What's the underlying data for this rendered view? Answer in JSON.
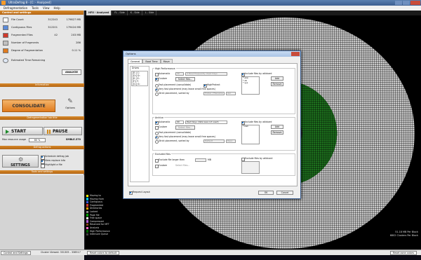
{
  "window": {
    "title": "UltraDefrag 8 - [C: - Analyzed]",
    "menus": [
      "Defragmentation",
      "Tools",
      "View",
      "Help"
    ]
  },
  "panel": {
    "control_header": "Control and settings",
    "stats": [
      {
        "label": "File Count",
        "count": "312243",
        "size": "179827 MB",
        "color": "#ffffff"
      },
      {
        "label": "Contiguous Files",
        "count": "312201",
        "size": "179424 MB",
        "color": "#5b8bd9"
      },
      {
        "label": "Fragmented Files",
        "count": "42",
        "size": "203 MB",
        "color": "#d0392b"
      },
      {
        "label": "Number of Fragments",
        "count": "",
        "size": "286",
        "color": "#c0c0c0"
      },
      {
        "label": "Degree of Fragmentation",
        "count": "",
        "size": "0.11 %",
        "color": "#e07b1e"
      }
    ],
    "estimated_label": "Estimated Time Remaining",
    "analyze_label": "ANALYZE",
    "information_label": "Information",
    "consolidate_label": "CONSOLIDATE",
    "options_label": "Options",
    "defrag_section_label": "Defragmentation tab title",
    "start_label": "START",
    "pause_label": "PAUSE",
    "resource_label": "Max resource usage",
    "resource_value": "80 %",
    "speed_value": "SMBLE.370",
    "defrag_actions_label": "Defrag actions",
    "settings_label": "SETTINGS",
    "checks": [
      {
        "label": "Schedule defrag job",
        "on": true
      },
      {
        "label": "View replace info",
        "on": true
      },
      {
        "label": "Highlight a file",
        "on": false
      }
    ],
    "tools_label": "Tools and settings"
  },
  "map": {
    "tabs": [
      "HFO - Analyzed",
      "FL - Side",
      "K - Side",
      "L - Side"
    ],
    "legend": [
      {
        "label": "Moving to",
        "color": "#ffff00"
      },
      {
        "label": "Moving from",
        "color": "#00c8ff"
      },
      {
        "label": "Contiguous",
        "color": "#3b5bd9"
      },
      {
        "label": "Fragmented",
        "color": "#d0392b"
      },
      {
        "label": "Directories",
        "color": "#ffa500"
      },
      {
        "label": "Locked",
        "color": "#888888"
      },
      {
        "label": "Page file",
        "color": "#00a000"
      },
      {
        "label": "Free space",
        "color": "#ffffff"
      },
      {
        "label": "Compressed",
        "color": "#b060d0"
      },
      {
        "label": "Reserved for MFT",
        "color": "#8b4513"
      },
      {
        "label": "Analysis",
        "color": "#ff66cc"
      },
      {
        "label": "High Performance",
        "color": "#006400"
      },
      {
        "label": "Intensive Queue",
        "color": "#404040"
      }
    ],
    "info_line1": "51.18 MB Per Block",
    "info_line2": "6802 Clusters Per Block"
  },
  "dialog": {
    "title": "Options",
    "tabs": [
      "General",
      "Boot Time",
      "Move"
    ],
    "drives_label": "Drives",
    "drives": [
      "[E:] C:",
      "[D:] D:",
      "[E:] E:",
      "[F:] F:",
      "[G:] G:"
    ],
    "hp_group": "High Performance",
    "hp_automatic": "Automatic",
    "hp_automatic_value": "30",
    "hp_automatic_select": "3 Most Frequently Used Days",
    "hp_custom": "Custom",
    "hp_select_files": "Select files...",
    "hp_fast": "Fast placement (consolidate)",
    "hp_highprotect": "HighProtect",
    "hp_very_fast": "Very fast placement (may leave small free spaces)",
    "hp_strict": "Strict placement, sorted by",
    "hp_sort_by": "Folder / Filename",
    "hp_sort_order": "Asc",
    "incl_wildcard": "Include files by wildcard",
    "hp_wildcards": [
      "*.exe",
      "*.dll",
      "*.sys"
    ],
    "add": "Add",
    "remove": "Remove",
    "ar_group": "Archive",
    "ar_automatic": "Automatic",
    "ar_automatic_value": "90",
    "ar_automatic_select": "Past Days (data was not used)",
    "ar_custom": "Custom",
    "ar_select_files": "Select files...",
    "ar_fast": "Fast placement (consolidate)",
    "ar_very_fast": "Very fast placement (may leave small free spaces)",
    "ar_strict": "Strict placement, sorted by",
    "ar_sort_by": "Default",
    "ar_sort_order": "Desc",
    "ar_wildcards": [
      "*.bak"
    ],
    "ex_group": "Excluded files",
    "ex_larger": "Exclude file larger then",
    "ex_unit": "MB",
    "ex_custom": "Custom",
    "ex_select_files": "Select files...",
    "ex_wildcard": "Exclude files by wildcard",
    "restart_label": "Request Layout",
    "ok": "OK",
    "cancel": "Cancel"
  },
  "status": {
    "tab1": "Control and Settings",
    "clusters": "Cluster Viewed: 331305 - 338517",
    "reset_colors": "Reset colors to default",
    "reset_zone": "Reset zone colors"
  }
}
